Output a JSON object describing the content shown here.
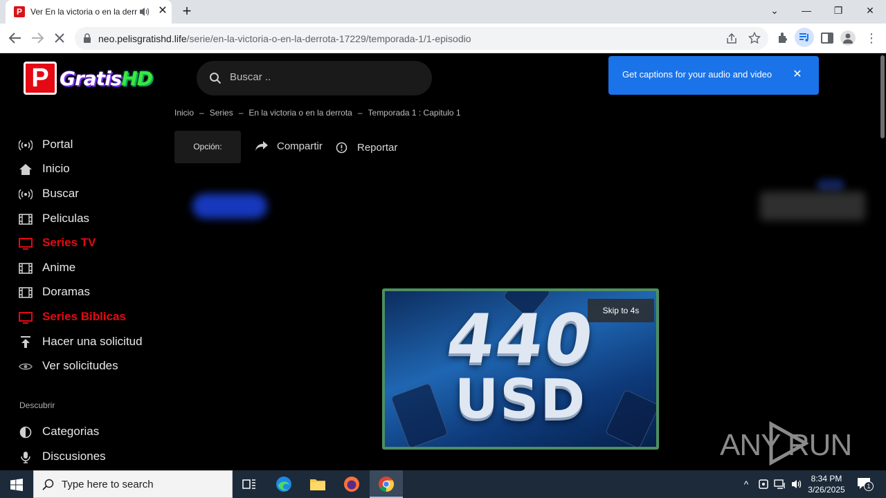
{
  "browser": {
    "tab_title": "Ver En la victoria o en la derr",
    "tab_favicon_letter": "P",
    "url_domain": "neo.pelisgratishd.life",
    "url_path": "/serie/en-la-victoria-o-en-la-derrota-17229/temporada-1/1-episodio"
  },
  "site": {
    "logo_letter": "P",
    "logo_word_main": "Gratis",
    "logo_word_accent": "HD",
    "search_placeholder": "Buscar .."
  },
  "sidebar": {
    "items": [
      {
        "label": "Portal",
        "icon": "broadcast-icon",
        "active": false
      },
      {
        "label": "Inicio",
        "icon": "home-icon",
        "active": false
      },
      {
        "label": "Buscar",
        "icon": "broadcast-icon",
        "active": false
      },
      {
        "label": "Peliculas",
        "icon": "film-icon",
        "active": false
      },
      {
        "label": "Series TV",
        "icon": "tv-icon",
        "active": true
      },
      {
        "label": "Anime",
        "icon": "film-icon",
        "active": false
      },
      {
        "label": "Doramas",
        "icon": "film-icon",
        "active": false
      },
      {
        "label": "Series Biblicas",
        "icon": "tv-icon",
        "active": true
      },
      {
        "label": "Hacer una solicitud",
        "icon": "upload-icon",
        "active": false
      },
      {
        "label": "Ver solicitudes",
        "icon": "eye-icon",
        "active": false
      }
    ],
    "section_label": "Descubrir",
    "discover": [
      {
        "label": "Categorias",
        "icon": "half-circle-icon"
      },
      {
        "label": "Discusiones",
        "icon": "microphone-icon"
      }
    ]
  },
  "breadcrumb": [
    "Inicio",
    "Series",
    "En la victoria o en la derrota",
    "Temporada 1 : Capitulo 1"
  ],
  "breadcrumb_sep": "–",
  "actions": {
    "option_label": "Opción:",
    "share_label": "Compartir",
    "report_label": "Reportar"
  },
  "ad": {
    "amount": "440",
    "currency": "USD",
    "skip_label": "Skip to 4s"
  },
  "captions_popup": {
    "text": "Get captions for your audio and video"
  },
  "watermark": "ANY RUN",
  "taskbar": {
    "search_placeholder": "Type here to search",
    "time": "8:34 PM",
    "date": "3/26/2025",
    "notification_count": "1"
  },
  "colors": {
    "accent_red": "#e50914",
    "caption_blue": "#1a73e8",
    "ad_border": "#4e8f5f"
  }
}
